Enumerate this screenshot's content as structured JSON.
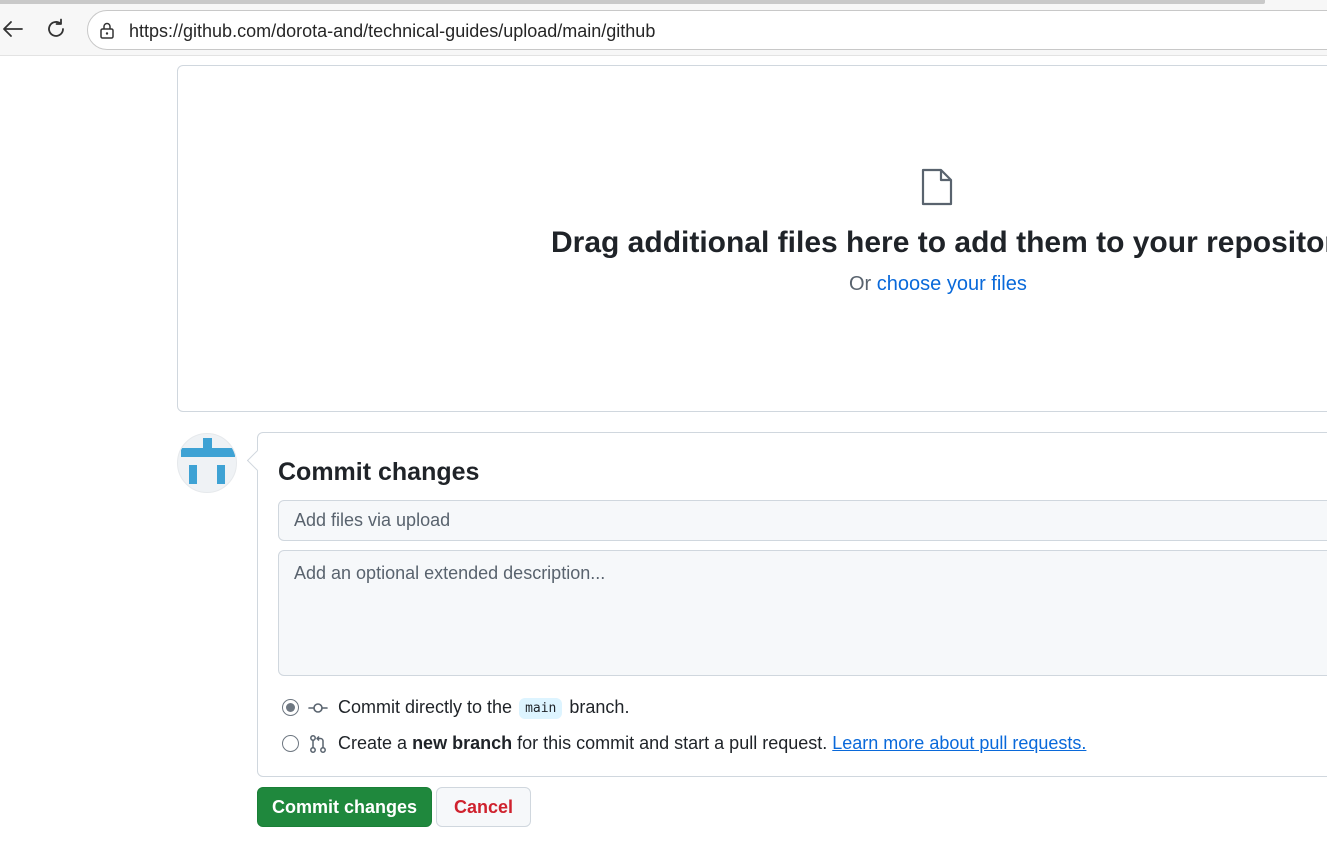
{
  "browser": {
    "url": "https://github.com/dorota-and/technical-guides/upload/main/github",
    "icons": {
      "back": "arrow-left-icon",
      "reload": "reload-icon",
      "lock": "lock-icon"
    }
  },
  "dropzone": {
    "icon": "file-icon",
    "title": "Drag additional files here to add them to your repository",
    "or_text": "Or",
    "link_text": "choose your files"
  },
  "commit": {
    "title": "Commit changes",
    "summary_placeholder": "Add files via upload",
    "description_placeholder": "Add an optional extended description...",
    "option_direct": {
      "checked": true,
      "prefix": "Commit directly to the",
      "branch": "main",
      "suffix": "branch."
    },
    "option_new_branch": {
      "checked": false,
      "prefix": "Create a",
      "bold": "new branch",
      "suffix": "for this commit and start a pull request.",
      "link": "Learn more about pull requests."
    }
  },
  "buttons": {
    "commit": "Commit changes",
    "cancel": "Cancel"
  },
  "colors": {
    "primary": "#1f883d",
    "link": "#0969da",
    "danger": "#cf222e",
    "avatar_blue": "#3ea2d4"
  }
}
